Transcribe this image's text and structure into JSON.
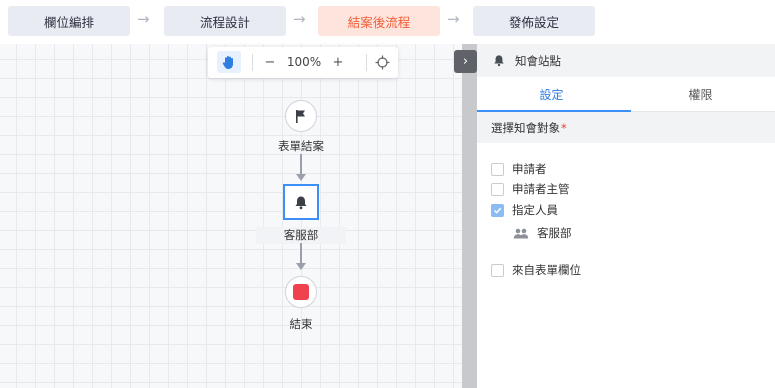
{
  "steps": [
    {
      "label": "欄位編排",
      "active": false
    },
    {
      "label": "流程設計",
      "active": false
    },
    {
      "label": "結案後流程",
      "active": true
    },
    {
      "label": "發佈設定",
      "active": false
    }
  ],
  "step_arrow": "→",
  "toolbar": {
    "zoom_out": "−",
    "zoom_level": "100%",
    "zoom_in": "+"
  },
  "flow": {
    "nodes": [
      {
        "label": "表單結案",
        "icon": "flag-icon"
      },
      {
        "label": "客服部",
        "icon": "bell-icon"
      },
      {
        "label": "結束",
        "icon": "stop-icon"
      }
    ]
  },
  "panel": {
    "collapse_glyph": "›",
    "title": "知會站點",
    "tabs": [
      "設定",
      "權限"
    ],
    "section_label": "選擇知會對象",
    "required_mark": "*",
    "options": [
      {
        "label": "申請者",
        "checked": false
      },
      {
        "label": "申請者主管",
        "checked": false
      },
      {
        "label": "指定人員",
        "checked": true
      }
    ],
    "assigned_member": "客服部",
    "extra_option": {
      "label": "來自表單欄位",
      "checked": false
    }
  },
  "colors": {
    "accent": "#3d8ef7",
    "active_step_bg": "#fde4dd",
    "active_step_text": "#f0603a",
    "end_node": "#f0414e"
  }
}
